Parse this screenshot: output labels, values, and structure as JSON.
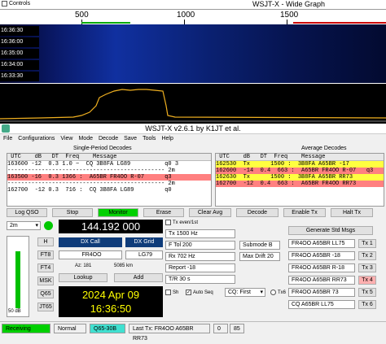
{
  "wide_graph": {
    "title": "WSJT-X - Wide Graph",
    "controls_label": "Controls",
    "scale_labels": [
      "500",
      "1000",
      "1500"
    ],
    "time_labels": [
      "16:36:30",
      "16:36:00",
      "16:35:00",
      "16:34:00",
      "16:33:30"
    ],
    "tag": "2m"
  },
  "main_window": {
    "title": "WSJT-X   v2.6.1   by K1JT et al.",
    "menu": [
      "File",
      "Configurations",
      "View",
      "Mode",
      "Decode",
      "Save",
      "Tools",
      "Help"
    ],
    "left_title": "Single-Period Decodes",
    "right_title": "Average Decodes",
    "left_header": " UTC    dB   DT  Freq    Message",
    "left_rows": [
      "163500 -16  0.3 1366 :  A65BR FR4OO R-07      q3",
      "163600 -12  0.3 1.0 ~  CQ 3B8FA LG89          q0 3",
      "---------------------------------------------- 2m",
      "163500 -16  0.3 1366 :  A65BR FR4OO R-07      q3",
      "---------------------------------------------- 2m",
      "162700  -12 0.3  716 :  CQ 3B8FA LG89         q0"
    ],
    "right_header": " UTC    dB   DT  Freq    Message",
    "right_rows": [
      "162530  Tx      1500 :  3B8FA A65BR -17",
      "162600  -14  0.4  663 :  A65BR FR4OO R-07   q3",
      "162630  Tx      1500 :  3B8FA A65BR RR73",
      "162700  -12  0.4  663 :  A65BR FR4OO RR73"
    ],
    "buttons": [
      "Log QSO",
      "Stop",
      "Monitor",
      "Erase",
      "Clear Avg",
      "Decode",
      "Enable Tx",
      "Halt Tx"
    ],
    "band": "2m",
    "frequency": "144.192 000",
    "dx_call_label": "DX Call",
    "dx_grid_label": "DX Grid",
    "dx_call": "FR4OO",
    "dx_grid": "LG79",
    "az_label": "Az: 181",
    "dist_label": "5085 km",
    "lookup": "Lookup",
    "add": "Add",
    "date": "2024 Apr 09",
    "time": "16:36:50",
    "mode_buttons": [
      "H",
      "FT8",
      "FT4",
      "MSK",
      "Q65",
      "JT65"
    ],
    "db_label": "50 dB",
    "tx_even": "Tx even/1st",
    "tx_freq": "Tx  1500  Hz",
    "f_tol": "F Tol  200",
    "rx_freq": "Rx  702  Hz",
    "report": "Report  -18",
    "tr": "T/R  30  s",
    "submode": "Submode B",
    "max_drift": "Max Drift  20",
    "sh": "Sh",
    "auto_seq": "Auto Seq",
    "cq": "CQ: First",
    "tx6": "Tx6",
    "gen_std": "Generate Std Msgs",
    "tx_msgs": [
      "FR4OO A65BR LL75",
      "FR4OO A65BR -18",
      "FR4OO A65BR R-18",
      "FR4OO A65BR RR73",
      "FR4OO A65BR 73",
      "CQ A65BR LL75"
    ],
    "tx_btns": [
      "Tx 1",
      "Tx 2",
      "Tx 3",
      "Tx 4",
      "Tx 5",
      "Tx 6"
    ],
    "status": {
      "receiving": "Receiving",
      "normal": "Normal",
      "mode": "Q65-30B",
      "last_tx": "Last Tx: FR4OO A65BR RR73",
      "s": "0",
      "n": "85"
    }
  }
}
